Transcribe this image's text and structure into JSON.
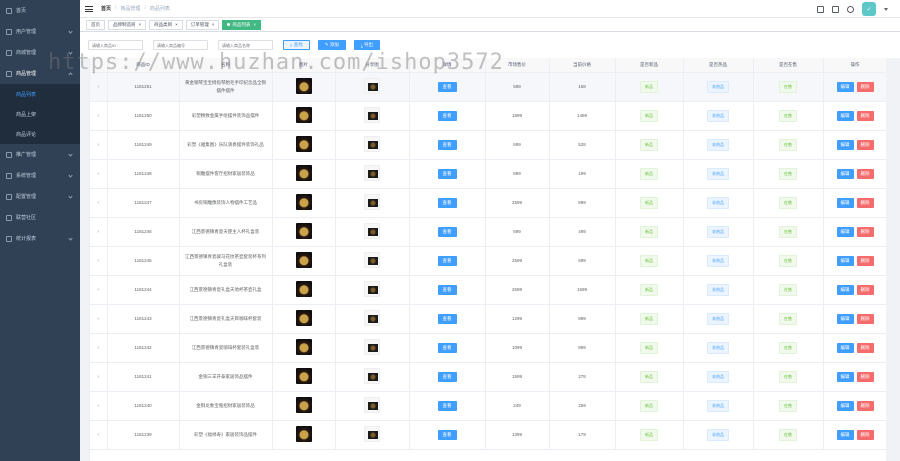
{
  "sidebar": {
    "home": "首页",
    "menus": [
      {
        "label": "用户管理"
      },
      {
        "label": "商城管理"
      },
      {
        "label": "商品管理"
      }
    ],
    "submenus": [
      {
        "label": "商品列表"
      },
      {
        "label": "商品上架"
      },
      {
        "label": "商品评论"
      }
    ],
    "menus_after": [
      {
        "label": "推广管理"
      },
      {
        "label": "系统管理"
      },
      {
        "label": "配置管理"
      },
      {
        "label": "联营社区"
      },
      {
        "label": "统计报表"
      }
    ]
  },
  "navbar": {
    "breadcrumb": [
      "首页",
      "商品管理",
      "商品列表"
    ],
    "avatar_text": "✓"
  },
  "tags": [
    {
      "label": "首页"
    },
    {
      "label": "品牌制造商"
    },
    {
      "label": "商品类目"
    },
    {
      "label": "订单管理"
    },
    {
      "label": "商品列表",
      "active": true
    }
  ],
  "filters": {
    "placeholders": [
      "请输入商品ID",
      "请输入商品编号",
      "请输入商品名称"
    ],
    "buttons": [
      "查找",
      "添加",
      "导出"
    ]
  },
  "table": {
    "headers": [
      "",
      "商品ID",
      "名称",
      "图片",
      "分享图",
      "详情",
      "市场售价",
      "当前价格",
      "是否新品",
      "是否热品",
      "是否在售",
      "操作"
    ],
    "view_label": "查看",
    "edit_label": "编辑",
    "delete_label": "删除",
    "rows": [
      {
        "id": "1181251",
        "name": "黄金钢琴宝宝拇指琴胎毛手印纪念品全铜摆件摆件",
        "market": "599",
        "price": "158",
        "new": "新品",
        "hot": "非热品",
        "sale": "在售"
      },
      {
        "id": "1181250",
        "name": "彩塑精致金属手绘摆件装饰品摆件",
        "market": "1899",
        "price": "1499",
        "new": "新品",
        "hot": "非热品",
        "sale": "在售"
      },
      {
        "id": "1181249",
        "name": "彩塑《雅集图》乐队演奏摆件装饰礼品",
        "market": "699",
        "price": "528",
        "new": "新品",
        "hot": "非热品",
        "sale": "在售"
      },
      {
        "id": "1181248",
        "name": "铜雕摆件客厅招财家居装饰品",
        "market": "899",
        "price": "199",
        "new": "新品",
        "hot": "非热品",
        "sale": "在售"
      },
      {
        "id": "1181247",
        "name": "书房铜雕像装饰人物摆件工艺品",
        "market": "2599",
        "price": "899",
        "new": "新品",
        "hot": "非热品",
        "sale": "在售"
      },
      {
        "id": "1181246",
        "name": "江西景德镇青瓷天使主人杯礼盒装",
        "market": "699",
        "price": "499",
        "new": "新品",
        "hot": "非热品",
        "sale": "在售"
      },
      {
        "id": "1181245",
        "name": "江西景德镇青瓷骏马花纹茶壶套装杯系列礼盒装",
        "market": "2599",
        "price": "699",
        "new": "新品",
        "hot": "非热品",
        "sale": "在售"
      },
      {
        "id": "1181244",
        "name": "江西景德镇青瓷礼盒天地杯茶壶礼盒",
        "market": "2599",
        "price": "1599",
        "new": "新品",
        "hot": "非热品",
        "sale": "在售"
      },
      {
        "id": "1181243",
        "name": "江西景德镇青瓷礼盒天目咖啡杯套装",
        "market": "1299",
        "price": "899",
        "new": "新品",
        "hot": "非热品",
        "sale": "在售"
      },
      {
        "id": "1181242",
        "name": "江西景德镇青瓷咖啡杯套装礼盒装",
        "market": "1099",
        "price": "899",
        "new": "新品",
        "hot": "非热品",
        "sale": "在售"
      },
      {
        "id": "1181241",
        "name": "金铜三羊开泰家居饰品摆件",
        "market": "1599",
        "price": "278",
        "new": "新品",
        "hot": "非热品",
        "sale": "在售"
      },
      {
        "id": "1181240",
        "name": "金铜龙象宝瓶招财家居装饰品",
        "market": "249",
        "price": "259",
        "new": "新品",
        "hot": "非热品",
        "sale": "在售"
      },
      {
        "id": "1181239",
        "name": "彩塑《福禄寿》家居装饰品摆件",
        "market": "1399",
        "price": "179",
        "new": "新品",
        "hot": "非热品",
        "sale": "在售"
      }
    ]
  },
  "watermark": "https://www.huzhan.com/ishop3572"
}
